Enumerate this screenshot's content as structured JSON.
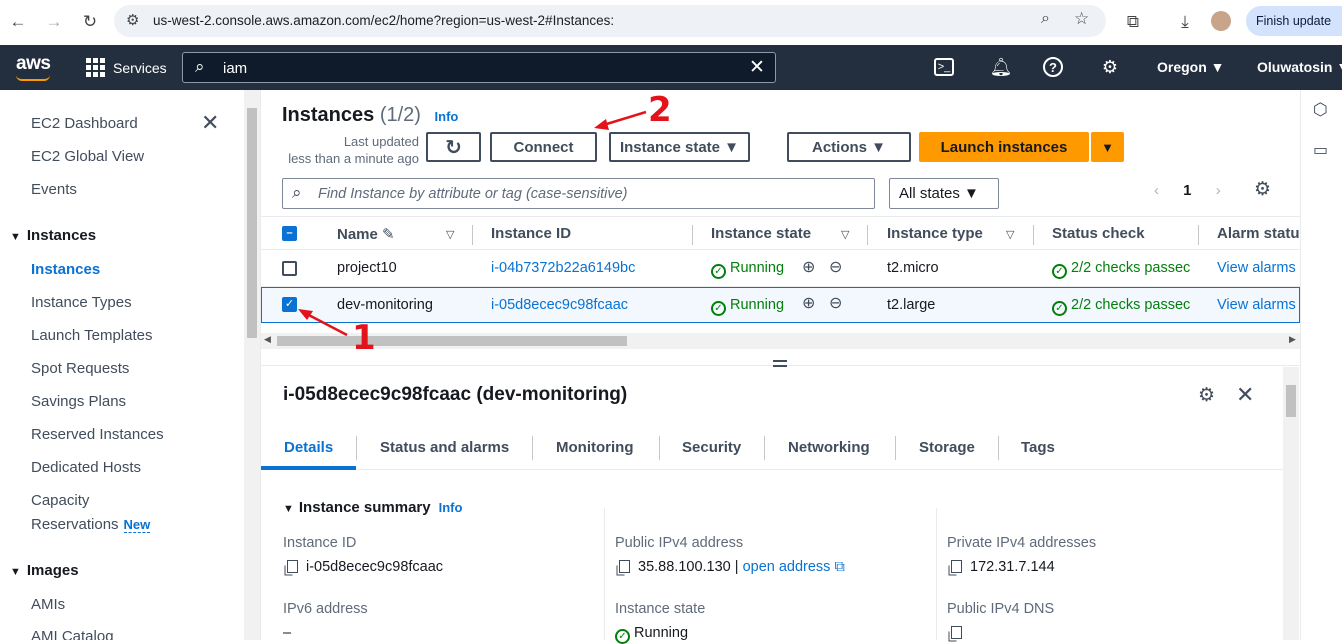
{
  "browser": {
    "url": "us-west-2.console.aws.amazon.com/ec2/home?region=us-west-2#Instances:",
    "finish_update": "Finish update"
  },
  "topnav": {
    "logo": "aws",
    "services": "Services",
    "search_value": "iam",
    "region": "Oregon ▼",
    "user": "Oluwatosin ▼"
  },
  "sidebar": {
    "top_items": [
      "EC2 Dashboard",
      "EC2 Global View",
      "Events"
    ],
    "section_instances": "Instances",
    "instances_items": [
      "Instances",
      "Instance Types",
      "Launch Templates",
      "Spot Requests",
      "Savings Plans",
      "Reserved Instances",
      "Dedicated Hosts",
      "Capacity",
      "Reservations"
    ],
    "new_badge": "New",
    "section_images": "Images",
    "images_items": [
      "AMIs",
      "AMI Catalog"
    ]
  },
  "header": {
    "title": "Instances",
    "count": "(1/2)",
    "info": "Info",
    "last_updated_1": "Last updated",
    "last_updated_2": "less than a minute ago",
    "connect": "Connect",
    "instance_state": "Instance state ▼",
    "actions": "Actions ▼",
    "launch": "Launch instances",
    "launch_caret": "▼"
  },
  "filter": {
    "placeholder": "Find Instance by attribute or tag (case-sensitive)",
    "states": "All states ▼",
    "page": "1"
  },
  "table": {
    "columns": [
      "Name",
      "Instance ID",
      "Instance state",
      "Instance type",
      "Status check",
      "Alarm statu"
    ],
    "rows": [
      {
        "name": "project10",
        "id": "i-04b7372b22a6149bc",
        "state": "Running",
        "type": "t2.micro",
        "status": "2/2 checks passec",
        "alarm": "View alarms",
        "selected": false
      },
      {
        "name": "dev-monitoring",
        "id": "i-05d8ecec9c98fcaac",
        "state": "Running",
        "type": "t2.large",
        "status": "2/2 checks passec",
        "alarm": "View alarms",
        "selected": true
      }
    ]
  },
  "details": {
    "title": "i-05d8ecec9c98fcaac (dev-monitoring)",
    "tabs": [
      "Details",
      "Status and alarms",
      "Monitoring",
      "Security",
      "Networking",
      "Storage",
      "Tags"
    ],
    "summary": "Instance summary",
    "info": "Info",
    "instance_id_label": "Instance ID",
    "instance_id": "i-05d8ecec9c98fcaac",
    "public_ipv4_label": "Public IPv4 address",
    "public_ipv4": "35.88.100.130",
    "open_address": "open address",
    "private_ipv4_label": "Private IPv4 addresses",
    "private_ipv4": "172.31.7.144",
    "ipv6_label": "IPv6 address",
    "ipv6": "–",
    "instance_state_label": "Instance state",
    "instance_state": "Running",
    "public_dns_label": "Public IPv4 DNS"
  },
  "annotations": {
    "one": "1",
    "two": "2"
  }
}
